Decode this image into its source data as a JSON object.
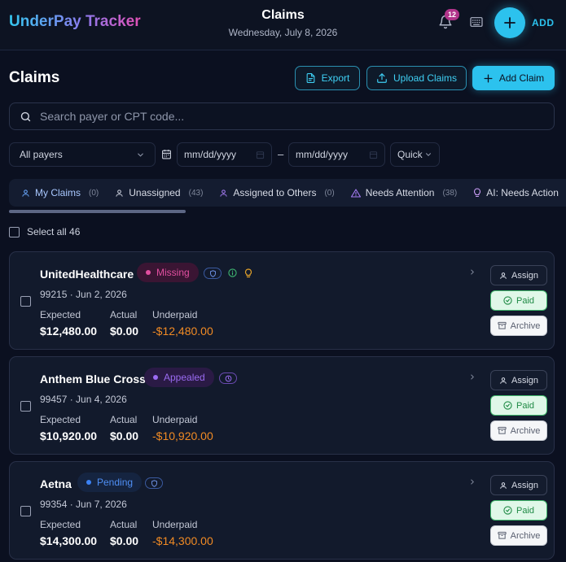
{
  "app": {
    "brand": "UnderPay Tracker",
    "title": "Claims",
    "date": "Wednesday, July 8, 2026"
  },
  "header": {
    "notifications_count": "12",
    "add_label": "ADD"
  },
  "toolbar": {
    "heading": "Claims",
    "export_label": "Export",
    "upload_label": "Upload Claims",
    "add_claim_label": "Add Claim"
  },
  "search": {
    "placeholder": "Search payer or CPT code..."
  },
  "filters": {
    "payer_selected": "All payers",
    "date_from_placeholder": "mm/dd/yyyy",
    "date_separator": "–",
    "date_to_placeholder": "mm/dd/yyyy",
    "quick_label": "Quick"
  },
  "tabs": [
    {
      "label": "My Claims",
      "count": "(0)",
      "icon": "user-icon"
    },
    {
      "label": "Unassigned",
      "count": "(43)",
      "icon": "user-icon"
    },
    {
      "label": "Assigned to Others",
      "count": "(0)",
      "icon": "user-icon"
    },
    {
      "label": "Needs Attention",
      "count": "(38)",
      "icon": "warning-icon"
    },
    {
      "label": "AI: Needs Action",
      "count": "",
      "icon": "lightbulb-icon"
    }
  ],
  "list": {
    "select_all_label": "Select all 46"
  },
  "labels": {
    "expected": "Expected",
    "actual": "Actual",
    "underpaid": "Underpaid",
    "assign": "Assign",
    "paid": "Paid",
    "archive": "Archive"
  },
  "claims": [
    {
      "payer": "UnitedHealthcare",
      "status": "Missing",
      "meta": "99215 · Jun 2, 2026",
      "expected": "$12,480.00",
      "actual": "$0.00",
      "underpaid": "-$12,480.00"
    },
    {
      "payer": "Anthem Blue Cross",
      "status": "Appealed",
      "meta": "99457 · Jun 4, 2026",
      "expected": "$10,920.00",
      "actual": "$0.00",
      "underpaid": "-$10,920.00"
    },
    {
      "payer": "Aetna",
      "status": "Pending",
      "meta": "99354 · Jun 7, 2026",
      "expected": "$14,300.00",
      "actual": "$0.00",
      "underpaid": "-$14,300.00"
    }
  ],
  "colors": {
    "accent": "#2cc2ee",
    "missing": "#e24fa0",
    "appealed": "#9b6bf2",
    "pending": "#3b82f6",
    "underpaid": "#f08a24",
    "paid": "#1f8a45"
  }
}
